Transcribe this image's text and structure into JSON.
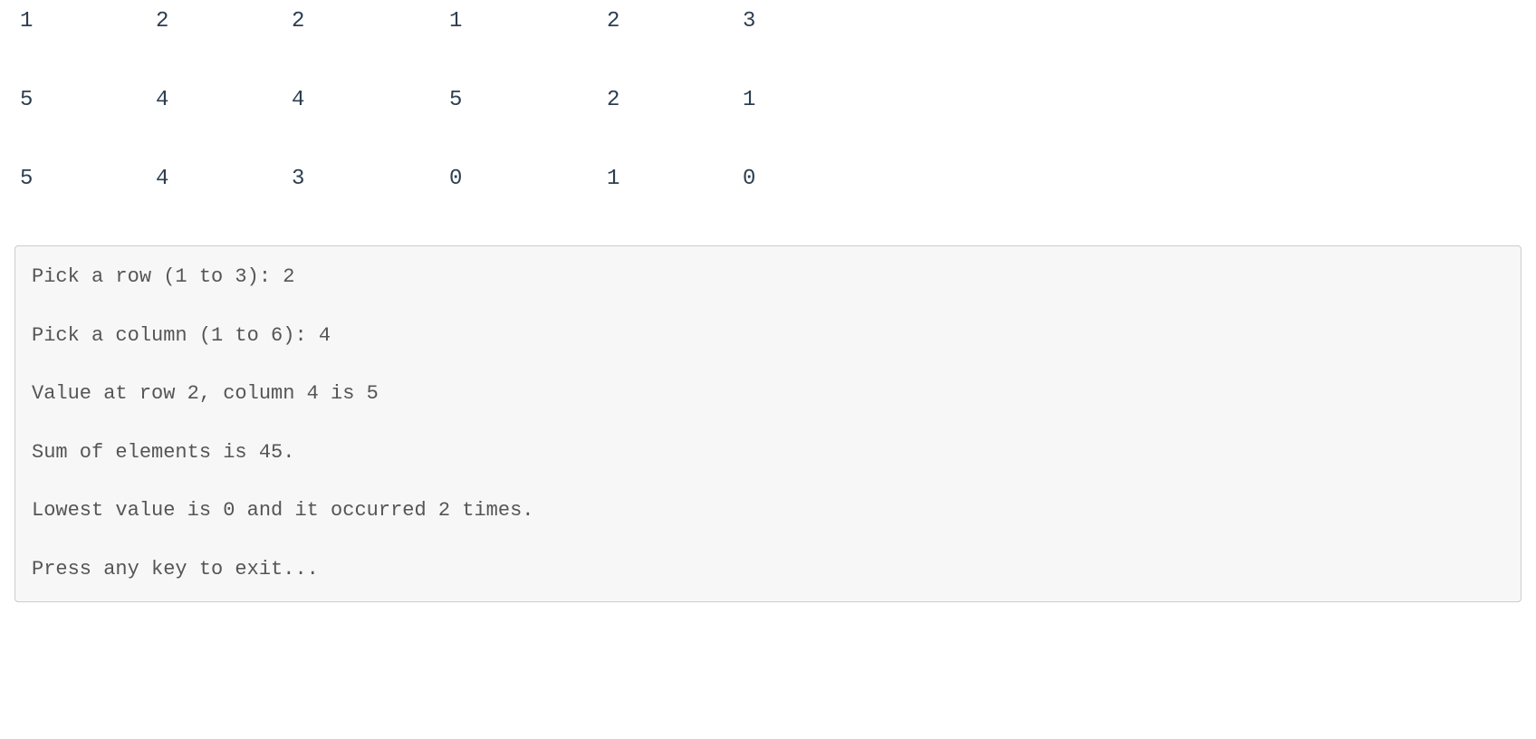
{
  "matrix": {
    "rows": [
      [
        "1",
        "2",
        "2",
        "1",
        "2",
        "3"
      ],
      [
        "5",
        "4",
        "4",
        "5",
        "2",
        "1"
      ],
      [
        "5",
        "4",
        "3",
        "0",
        "1",
        "0"
      ]
    ]
  },
  "console": {
    "lines": [
      "Pick a row (1 to 3): 2",
      "Pick a column (1 to 6): 4",
      "Value at row 2, column 4 is 5",
      "Sum of elements is 45.",
      "Lowest value is 0 and it occurred 2 times.",
      "Press any key to exit..."
    ]
  }
}
